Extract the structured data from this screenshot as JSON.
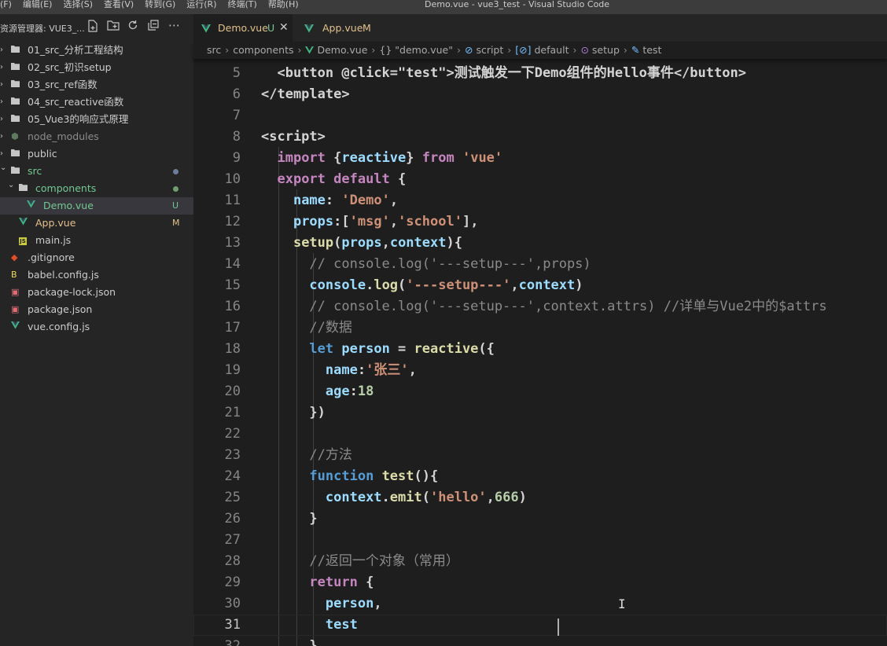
{
  "menubar": {
    "items": [
      "(F)",
      "编辑(E)",
      "选择(S)",
      "查看(V)",
      "转到(G)",
      "运行(R)",
      "终端(T)",
      "帮助(H)"
    ],
    "window_title": "Demo.vue - vue3_test - Visual Studio Code"
  },
  "sidebar": {
    "title": "资源管理器: VUE3_...",
    "actions": [
      "new-file-icon",
      "new-folder-icon",
      "refresh-icon",
      "collapse-all-icon",
      "more-actions-icon"
    ],
    "tree": [
      {
        "label": "01_src_分析工程结构",
        "type": "folder",
        "depth": 0
      },
      {
        "label": "02_src_初识setup",
        "type": "folder",
        "depth": 0
      },
      {
        "label": "03_src_ref函数",
        "type": "folder",
        "depth": 0
      },
      {
        "label": "04_src_reactive函数",
        "type": "folder",
        "depth": 0
      },
      {
        "label": "05_Vue3的响应式原理",
        "type": "folder",
        "depth": 0
      },
      {
        "label": "node_modules",
        "type": "node_modules",
        "depth": 0
      },
      {
        "label": "public",
        "type": "folder",
        "depth": 0
      },
      {
        "label": "src",
        "type": "folder-open",
        "depth": 0,
        "dot": true
      },
      {
        "label": "components",
        "type": "folder-open",
        "depth": 1,
        "dot": true
      },
      {
        "label": "Demo.vue",
        "type": "vue",
        "depth": 2,
        "status": "U",
        "selected": true
      },
      {
        "label": "App.vue",
        "type": "vue",
        "depth": 1,
        "status": "M"
      },
      {
        "label": "main.js",
        "type": "js",
        "depth": 1
      },
      {
        "label": ".gitignore",
        "type": "git",
        "depth": 0
      },
      {
        "label": "babel.config.js",
        "type": "babel",
        "depth": 0
      },
      {
        "label": "package-lock.json",
        "type": "json",
        "depth": 0
      },
      {
        "label": "package.json",
        "type": "json",
        "depth": 0
      },
      {
        "label": "vue.config.js",
        "type": "vue",
        "depth": 0
      }
    ]
  },
  "tabs": [
    {
      "label": "Demo.vue",
      "status": "U",
      "active": true
    },
    {
      "label": "App.vue",
      "status": "M",
      "active": false
    }
  ],
  "breadcrumb": [
    "src",
    "components",
    "Demo.vue",
    "{} \"demo.vue\"",
    "script",
    "default",
    "setup",
    "test"
  ],
  "colors": {
    "keyword": "#c586c0",
    "string": "#ce9178",
    "number": "#b5cea8",
    "function": "#dcdcaa",
    "variable": "#9cdcfe",
    "comment": "#8a8a8a",
    "text": "#d4d4d4",
    "tag": "#569cd6",
    "untracked": "#73c991",
    "modified": "#e2c08d",
    "ignored": "#8c8c8c"
  },
  "code": [
    {
      "n": "5",
      "tokens": [
        [
          "  ",
          "text"
        ],
        [
          "<button ",
          "text"
        ],
        [
          "@click",
          "text"
        ],
        [
          "=",
          "text"
        ],
        [
          "\"test\"",
          "text"
        ],
        [
          ">测试触发一下Demo组件的Hello事件</",
          "text"
        ],
        [
          "button",
          "text"
        ],
        [
          ">",
          "text"
        ]
      ]
    },
    {
      "n": "6",
      "tokens": [
        [
          "</template>",
          "text"
        ]
      ]
    },
    {
      "n": "7",
      "tokens": []
    },
    {
      "n": "8",
      "tokens": [
        [
          "<script>",
          "text"
        ]
      ]
    },
    {
      "n": "9",
      "tokens": [
        [
          "  ",
          "text"
        ],
        [
          "import",
          "keyword"
        ],
        [
          " {",
          "text"
        ],
        [
          "reactive",
          "variable"
        ],
        [
          "} ",
          "text"
        ],
        [
          "from",
          "keyword"
        ],
        [
          " ",
          "text"
        ],
        [
          "'vue'",
          "string"
        ]
      ]
    },
    {
      "n": "10",
      "tokens": [
        [
          "  ",
          "text"
        ],
        [
          "export default",
          "keyword"
        ],
        [
          " {",
          "text"
        ]
      ]
    },
    {
      "n": "11",
      "tokens": [
        [
          "    ",
          "text"
        ],
        [
          "name",
          "variable"
        ],
        [
          ": ",
          "text"
        ],
        [
          "'Demo'",
          "string"
        ],
        [
          ",",
          "text"
        ]
      ]
    },
    {
      "n": "12",
      "tokens": [
        [
          "    ",
          "text"
        ],
        [
          "props",
          "variable"
        ],
        [
          ":[",
          "text"
        ],
        [
          "'msg'",
          "string"
        ],
        [
          ",",
          "text"
        ],
        [
          "'school'",
          "string"
        ],
        [
          "],",
          "text"
        ]
      ]
    },
    {
      "n": "13",
      "tokens": [
        [
          "    ",
          "text"
        ],
        [
          "setup",
          "function"
        ],
        [
          "(",
          "text"
        ],
        [
          "props",
          "variable"
        ],
        [
          ",",
          "text"
        ],
        [
          "context",
          "variable"
        ],
        [
          "){",
          "text"
        ]
      ]
    },
    {
      "n": "14",
      "tokens": [
        [
          "      ",
          "text"
        ],
        [
          "// console.log('---setup---',props)",
          "comment"
        ]
      ]
    },
    {
      "n": "15",
      "tokens": [
        [
          "      ",
          "text"
        ],
        [
          "console",
          "variable"
        ],
        [
          ".",
          "text"
        ],
        [
          "log",
          "function"
        ],
        [
          "(",
          "text"
        ],
        [
          "'---setup---'",
          "string"
        ],
        [
          ",",
          "text"
        ],
        [
          "context",
          "variable"
        ],
        [
          ")",
          "text"
        ]
      ]
    },
    {
      "n": "16",
      "tokens": [
        [
          "      ",
          "text"
        ],
        [
          "// console.log('---setup---',context.attrs) //详单与Vue2中的$attrs",
          "comment"
        ]
      ]
    },
    {
      "n": "17",
      "tokens": [
        [
          "      ",
          "text"
        ],
        [
          "//数据",
          "comment"
        ]
      ]
    },
    {
      "n": "18",
      "tokens": [
        [
          "      ",
          "text"
        ],
        [
          "let",
          "tag"
        ],
        [
          " ",
          "text"
        ],
        [
          "person",
          "variable"
        ],
        [
          " = ",
          "text"
        ],
        [
          "reactive",
          "function"
        ],
        [
          "({",
          "text"
        ]
      ]
    },
    {
      "n": "19",
      "tokens": [
        [
          "        ",
          "text"
        ],
        [
          "name",
          "variable"
        ],
        [
          ":",
          "text"
        ],
        [
          "'张三'",
          "string"
        ],
        [
          ",",
          "text"
        ]
      ]
    },
    {
      "n": "20",
      "tokens": [
        [
          "        ",
          "text"
        ],
        [
          "age",
          "variable"
        ],
        [
          ":",
          "text"
        ],
        [
          "18",
          "number"
        ]
      ]
    },
    {
      "n": "21",
      "tokens": [
        [
          "      ",
          "text"
        ],
        [
          "})",
          "text"
        ]
      ]
    },
    {
      "n": "22",
      "tokens": []
    },
    {
      "n": "23",
      "tokens": [
        [
          "      ",
          "text"
        ],
        [
          "//方法",
          "comment"
        ]
      ]
    },
    {
      "n": "24",
      "tokens": [
        [
          "      ",
          "text"
        ],
        [
          "function",
          "tag"
        ],
        [
          " ",
          "text"
        ],
        [
          "test",
          "function"
        ],
        [
          "(){",
          "text"
        ]
      ]
    },
    {
      "n": "25",
      "tokens": [
        [
          "        ",
          "text"
        ],
        [
          "context",
          "variable"
        ],
        [
          ".",
          "text"
        ],
        [
          "emit",
          "function"
        ],
        [
          "(",
          "text"
        ],
        [
          "'hello'",
          "string"
        ],
        [
          ",",
          "text"
        ],
        [
          "666",
          "number"
        ],
        [
          ")",
          "text"
        ]
      ]
    },
    {
      "n": "26",
      "tokens": [
        [
          "      ",
          "text"
        ],
        [
          "}",
          "text"
        ]
      ]
    },
    {
      "n": "27",
      "tokens": []
    },
    {
      "n": "28",
      "tokens": [
        [
          "      ",
          "text"
        ],
        [
          "//返回一个对象（常用）",
          "comment"
        ]
      ]
    },
    {
      "n": "29",
      "tokens": [
        [
          "      ",
          "text"
        ],
        [
          "return",
          "keyword"
        ],
        [
          " {",
          "text"
        ]
      ]
    },
    {
      "n": "30",
      "tokens": [
        [
          "        ",
          "text"
        ],
        [
          "person",
          "variable"
        ],
        [
          ",",
          "text"
        ]
      ]
    },
    {
      "n": "31",
      "tokens": [
        [
          "        ",
          "text"
        ],
        [
          "test",
          "variable"
        ]
      ],
      "current": true
    },
    {
      "n": "32",
      "tokens": [
        [
          "      ",
          "text"
        ],
        [
          "}",
          "text"
        ]
      ]
    }
  ]
}
